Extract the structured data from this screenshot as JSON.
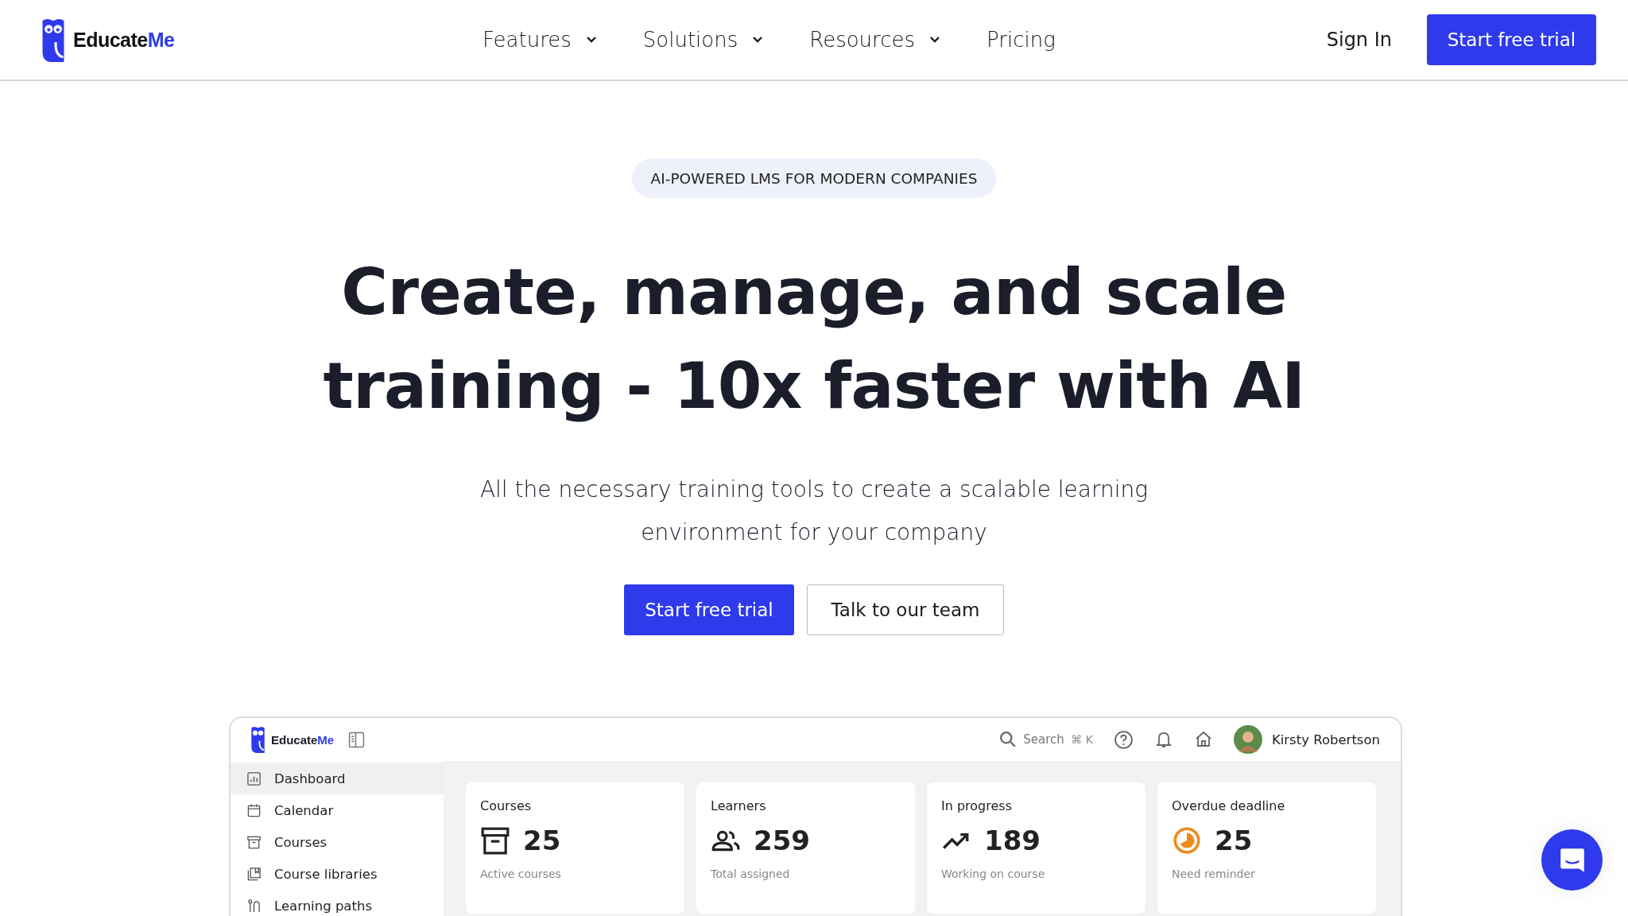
{
  "brand": {
    "name_dark": "Educate",
    "name_accent": "Me"
  },
  "nav": {
    "links": [
      {
        "label": "Features",
        "dropdown": true
      },
      {
        "label": "Solutions",
        "dropdown": true
      },
      {
        "label": "Resources",
        "dropdown": true
      },
      {
        "label": "Pricing",
        "dropdown": false
      }
    ],
    "sign_in": "Sign In",
    "cta": "Start free trial"
  },
  "hero": {
    "badge": "AI-POWERED LMS FOR MODERN COMPANIES",
    "headline_lines": [
      "Create, manage, and scale",
      "training - 10x faster with AI"
    ],
    "subtitle": "All the necessary training tools to create a scalable learning environment for your company",
    "primary_button": "Start free trial",
    "secondary_button": "Talk to our team"
  },
  "app_preview": {
    "brand": {
      "name_dark": "Educate",
      "name_accent": "Me"
    },
    "search": {
      "placeholder": "Search",
      "shortcut": "⌘ K"
    },
    "user_name": "Kirsty Robertson",
    "sidebar": {
      "items": [
        {
          "label": "Dashboard",
          "selected": true
        },
        {
          "label": "Calendar",
          "selected": false
        },
        {
          "label": "Courses",
          "selected": false
        },
        {
          "label": "Course libraries",
          "selected": false
        },
        {
          "label": "Learning paths",
          "selected": false
        }
      ]
    },
    "stats": [
      {
        "title": "Courses",
        "value": "25",
        "caption": "Active courses"
      },
      {
        "title": "Learners",
        "value": "259",
        "caption": "Total assigned"
      },
      {
        "title": "In progress",
        "value": "189",
        "caption": "Working on course"
      },
      {
        "title": "Overdue deadline",
        "value": "25",
        "caption": "Need reminder"
      }
    ]
  }
}
